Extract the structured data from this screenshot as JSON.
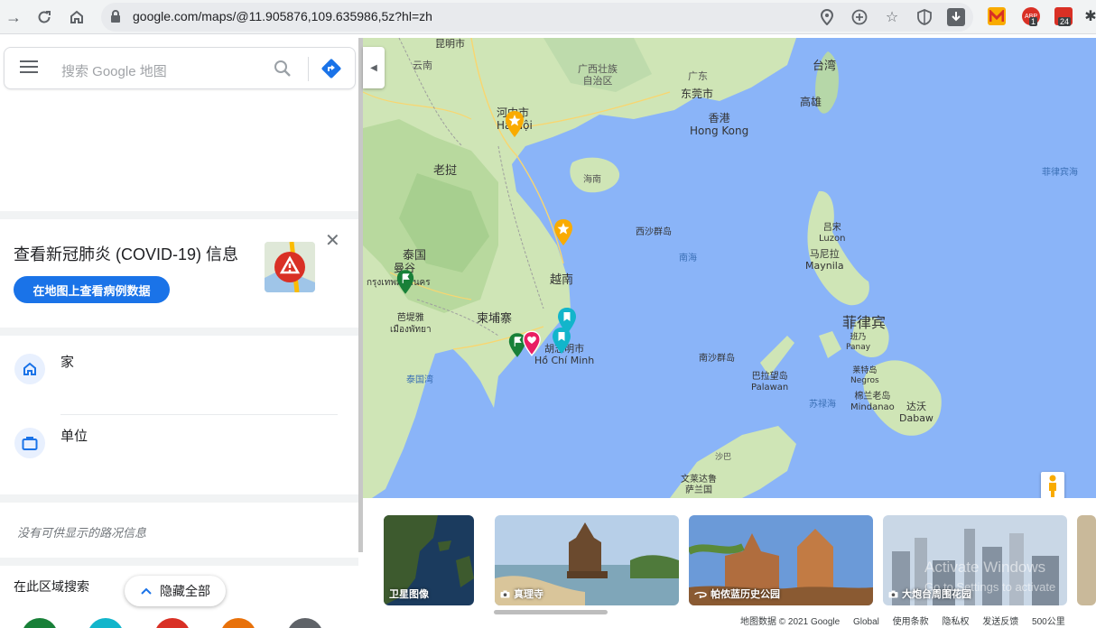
{
  "browser": {
    "url": "google.com/maps/@11.905876,109.635986,5z?hl=zh",
    "ext_badges": [
      "1",
      "24"
    ]
  },
  "search": {
    "placeholder": "搜索 Google 地图"
  },
  "covid": {
    "title": "查看新冠肺炎 (COVID-19) 信息",
    "button": "在地图上查看病例数据"
  },
  "places": [
    {
      "label": "家",
      "icon": "home-icon"
    },
    {
      "label": "单位",
      "icon": "briefcase-icon"
    }
  ],
  "traffic_text": "没有可供显示的路况信息",
  "area_search": "在此区域搜索",
  "hide_all": "隐藏全部",
  "category_colors": [
    "#188038",
    "#12b5cb",
    "#d93025",
    "#e8710a",
    "#5f6368"
  ],
  "map_labels": {
    "kunming": "昆明市",
    "yunnan": "云南",
    "guangxi": "广西壮族\n自治区",
    "guangdong": "广东",
    "dongguan": "东莞市",
    "hongkong": "香港\nHong Kong",
    "taiwan": "台湾",
    "kaohsiung": "高雄",
    "hanoi": "河内市\nHà Nội",
    "hainan": "海南",
    "laos": "老挝",
    "paracel": "西沙群岛",
    "southsea": "南海",
    "philippine_sea": "菲律宾海",
    "luzon": "吕宋\nLuzon",
    "manila": "马尼拉\nMaynila",
    "thailand": "泰国",
    "bangkok": "曼谷",
    "bangkok_th": "กรุงเทพมหานคร",
    "vietnam": "越南",
    "philippines": "菲律宾",
    "cambodia": "柬埔寨",
    "pattaya": "芭堤雅\nเมืองพัทยา",
    "hcm": "胡志明市\nHồ Chí Minh",
    "panay": "班乃\nPanay",
    "spratly": "南沙群岛",
    "palawan": "巴拉望岛\nPalawan",
    "negros": "莱特岛\nNegros",
    "mindanao": "棉兰老岛\nMindanao",
    "davao": "达沃\nDabaw",
    "gulf_thailand": "泰国湾",
    "sulu": "苏禄海",
    "sabah": "沙巴",
    "brunei": "文莱达鲁\n萨兰国"
  },
  "photos": [
    {
      "label": "卫星图像",
      "icon": ""
    },
    {
      "label": "真理寺",
      "icon": "camera-icon"
    },
    {
      "label": "帕侬蓝历史公园",
      "icon": "360-icon"
    },
    {
      "label": "大炮台周围花园",
      "icon": "camera-icon"
    }
  ],
  "footer": [
    "地图数据 © 2021 Google",
    "Global",
    "使用条款",
    "隐私权",
    "发送反馈",
    "500公里"
  ],
  "watermark": {
    "title": "Activate Windows",
    "sub": "Go to Settings to activate"
  }
}
